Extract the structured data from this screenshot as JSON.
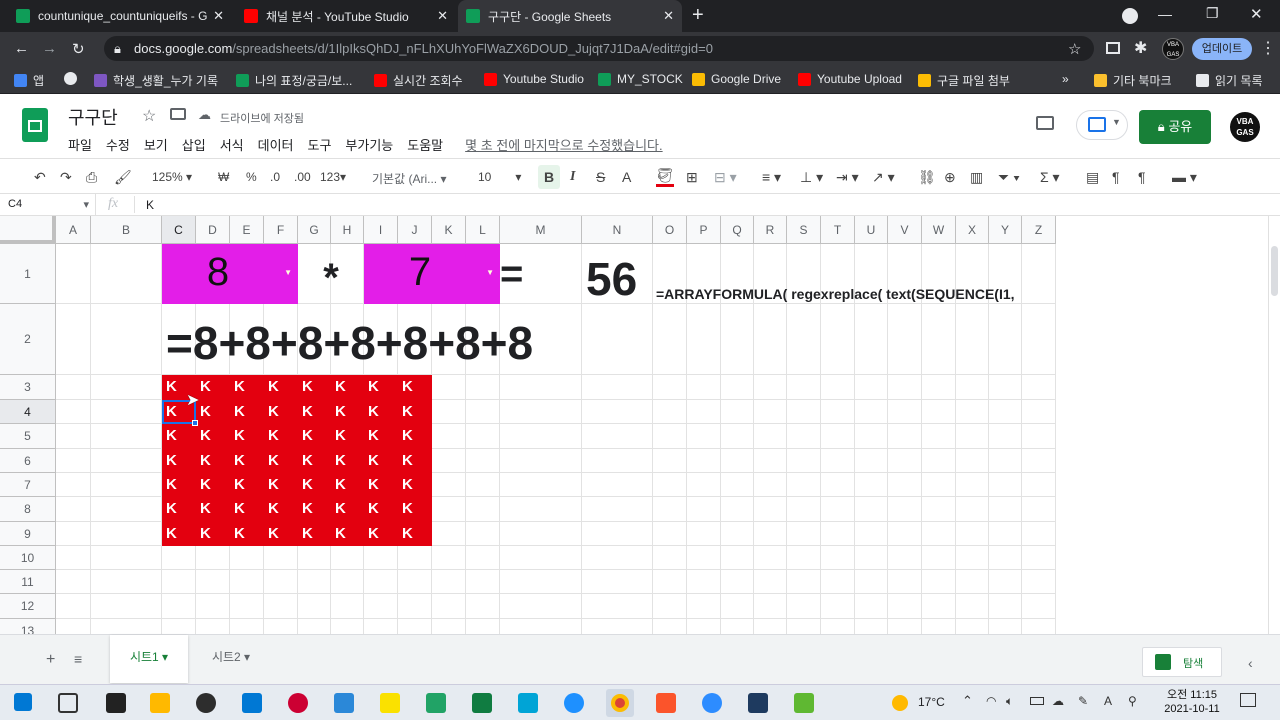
{
  "browser": {
    "tabs": [
      {
        "title": "countunique_countuniqueifs - G",
        "favicon_color": "#0f9d58",
        "active": false
      },
      {
        "title": "채널 분석 - YouTube Studio",
        "favicon_color": "#ff0000",
        "active": false
      },
      {
        "title": "구구단 - Google Sheets",
        "favicon_color": "#0f9d58",
        "active": true
      }
    ],
    "new_tab": "+",
    "url_host": "docs.google.com",
    "url_path": "/spreadsheets/d/1IlpIksQhDJ_nFLhXUhYoFlWaZX6DOUD_Jujqt7J1DaA/edit#gid=0",
    "update_button": "업데이트",
    "profile_badge": "VBA GAS",
    "bookmarks": [
      {
        "label": "앱",
        "color": "#4285f4"
      },
      {
        "label": "",
        "color": "#e8eaed"
      },
      {
        "label": "학생_생활_누가 기록",
        "color": "#7e57c2"
      },
      {
        "label": "나의 표정/궁금/보...",
        "color": "#0f9d58"
      },
      {
        "label": "실시간 조회수",
        "color": "#ff0000"
      },
      {
        "label": "Youtube Studio",
        "color": "#ff0000"
      },
      {
        "label": "MY_STOCK",
        "color": "#0f9d58"
      },
      {
        "label": "Google Drive",
        "color": "#fbbc04"
      },
      {
        "label": "Youtube Upload",
        "color": "#ff0000"
      },
      {
        "label": "구글 파일 첨부",
        "color": "#fbbc04"
      }
    ],
    "bookmarks_more": "»",
    "other_bookmarks": "기타 북마크",
    "reading_list": "읽기 목록"
  },
  "sheets": {
    "doc_title": "구구단",
    "saved_status": "드라이브에 저장됨",
    "menu": [
      "파일",
      "수정",
      "보기",
      "삽입",
      "서식",
      "데이터",
      "도구",
      "부가기능",
      "도움말"
    ],
    "last_edit": "몇 초 전에 마지막으로 수정했습니다.",
    "share_label": "공유",
    "avatar_text": "VBA GAS",
    "toolbar": {
      "zoom": "125%",
      "currency": "₩",
      "percent": "%",
      "dec_less": ".0",
      "dec_more": ".00",
      "format_more": "123",
      "font": "기본값 (Ari...",
      "font_size": "10",
      "bold": "B",
      "italic": "I",
      "strike": "S",
      "text_color": "A"
    },
    "name_box": "C4",
    "fx": "fx",
    "formula_value": "K",
    "columns": [
      "A",
      "B",
      "C",
      "D",
      "E",
      "F",
      "G",
      "H",
      "I",
      "J",
      "K",
      "L",
      "M",
      "N",
      "O",
      "P",
      "Q",
      "R",
      "S",
      "T",
      "U",
      "V",
      "W",
      "X",
      "Y",
      "Z"
    ],
    "rows": [
      "1",
      "2",
      "3",
      "4",
      "5",
      "6",
      "7",
      "8",
      "9",
      "10",
      "11",
      "12",
      "13"
    ],
    "selected_col": "C",
    "selected_row": "4",
    "cells": {
      "multiplicand": "8",
      "times": "*",
      "multiplier": "7",
      "equals": "=",
      "result": "56",
      "formula_text": "=ARRAYFORMULA( regexreplace( text(SEQUENCE(I1,",
      "expansion": "=8+8+8+8+8+8+8",
      "block_letter": "K",
      "block_rows": 7,
      "block_cols": 8
    },
    "colors": {
      "magenta": "#e31ee8",
      "red": "#e3000f",
      "accent_green": "#188038"
    },
    "sheet_tabs": [
      "시트1",
      "시트2"
    ],
    "explore": "탐색"
  },
  "taskbar": {
    "weather": "17°C",
    "time": "오전 11:15",
    "date": "2021-10-11"
  }
}
